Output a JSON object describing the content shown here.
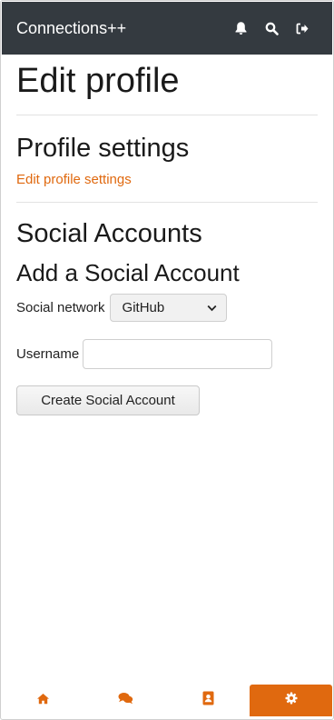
{
  "app": {
    "brand": "Connections++"
  },
  "header": {
    "icons": [
      "bell-icon",
      "search-icon",
      "logout-icon"
    ]
  },
  "page": {
    "title": "Edit profile"
  },
  "profile_settings": {
    "heading": "Profile settings",
    "link": "Edit profile settings"
  },
  "social": {
    "heading": "Social Accounts",
    "subheading": "Add a Social Account",
    "network_label": "Social network",
    "network_value": "GitHub",
    "username_label": "Username",
    "username_value": "",
    "submit_label": "Create Social Account"
  },
  "bottom_nav": {
    "tabs": [
      {
        "icon": "home-icon",
        "active": false
      },
      {
        "icon": "comments-icon",
        "active": false
      },
      {
        "icon": "contacts-icon",
        "active": false
      },
      {
        "icon": "gear-icon",
        "active": true
      }
    ]
  },
  "colors": {
    "topbar": "#343a40",
    "accent": "#e0690f"
  }
}
